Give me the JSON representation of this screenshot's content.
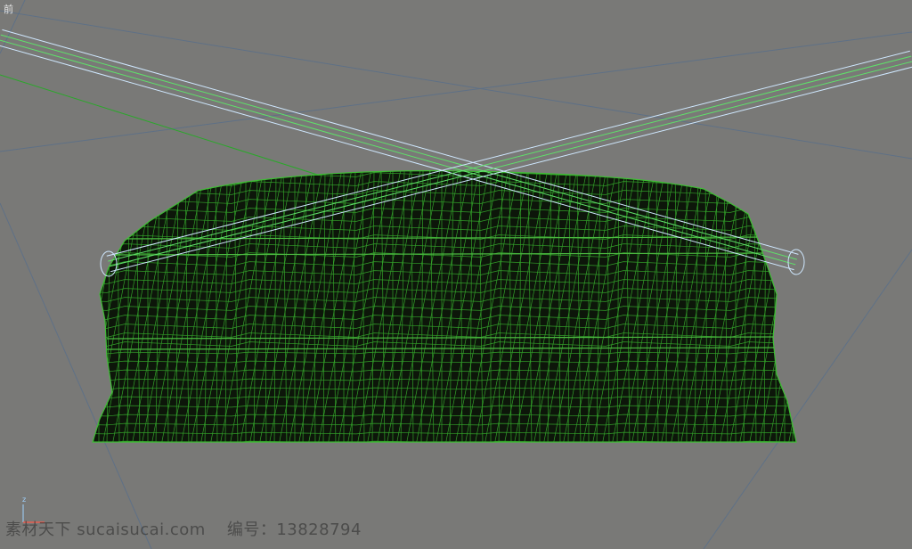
{
  "viewport": {
    "label": "前",
    "background": "#797977",
    "grid_color": "#5b6f86",
    "mesh_color": "#39b82f",
    "mesh_fill": "#0f1a0c",
    "rod_color": "#cfe8ff",
    "rod_inner_color": "#5fe06a"
  },
  "axis_gizmo": {
    "z_label": "z",
    "z_color": "#9fd3ff",
    "x_color": "#ff5a4a"
  },
  "watermark": {
    "site_text": "素材天下 sucaisucai.com",
    "id_text": "编号：13828794"
  }
}
